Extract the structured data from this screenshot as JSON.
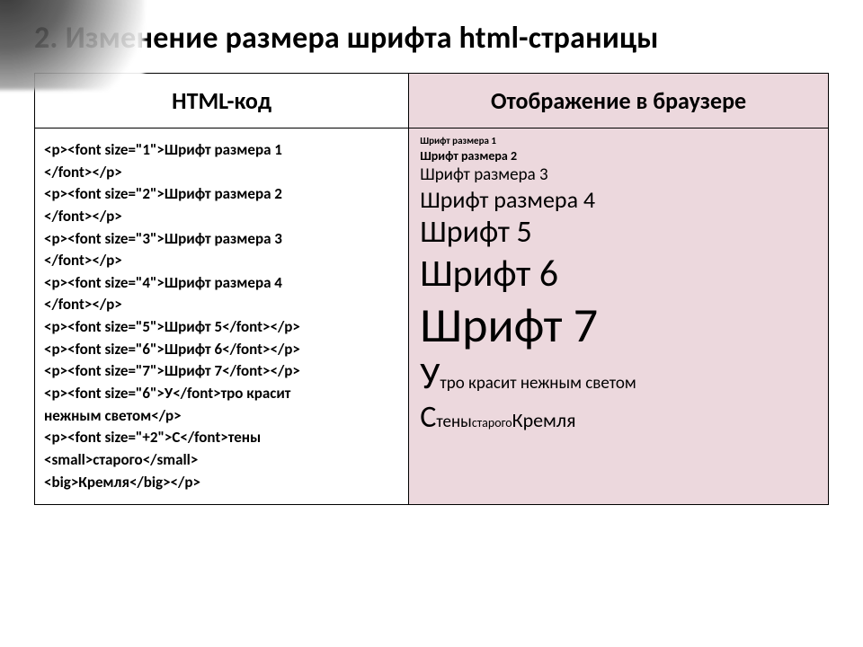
{
  "title": "2. Изменение размера шрифта html-страницы",
  "headers": {
    "left": "HTML-код",
    "right": "Отображение в браузере"
  },
  "code_lines": [
    "<p><font size=\"1\">Шрифт размера 1",
    "</font></p>",
    "<p><font size=\"2\">Шрифт размера 2",
    "</font></p>",
    "<p><font size=\"3\">Шрифт размера 3",
    "</font></p>",
    "<p><font size=\"4\">Шрифт размера 4",
    "</font></p>",
    "<p><font size=\"5\">Шрифт 5</font></p>",
    "<p><font size=\"6\">Шрифт 6</font></p>",
    "<p><font size=\"7\">Шрифт 7</font></p>",
    "<p><font size=\"6\">У</font>тро красит",
    "нежным светом</p>",
    "<p><font size=\"+2\">С</font>тены",
    "<small>старого</small>",
    "<big>Кремля</big></p>"
  ],
  "render": {
    "l1": "Шрифт размера 1",
    "l2": "Шрифт размера  2",
    "l3": "Шрифт размера 3",
    "l4": "Шрифт размера 4",
    "l5": "Шрифт 5",
    "l6": "Шрифт 6",
    "l7": "Шрифт 7",
    "utro_cap": "У",
    "utro_rest": "тро красит нежным светом",
    "steny_cap": "С",
    "steny_mid": "тены ",
    "steny_small": "старого",
    "steny_space": " ",
    "steny_big": "Кремля"
  }
}
